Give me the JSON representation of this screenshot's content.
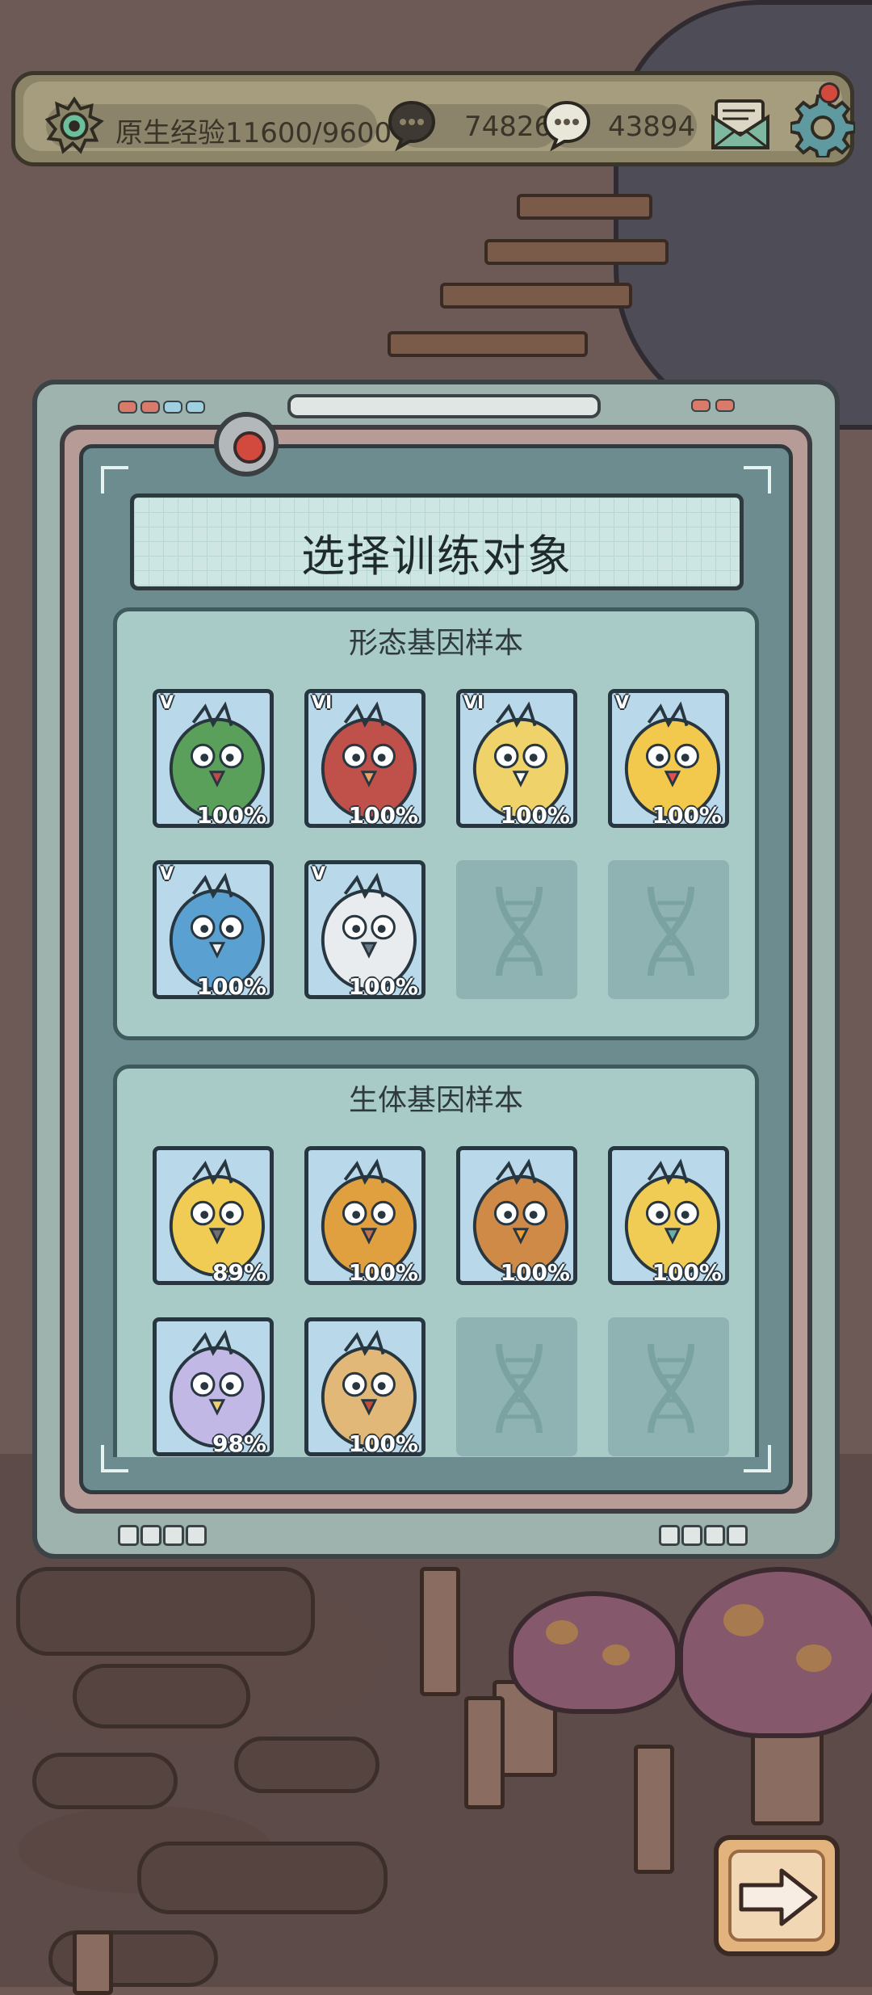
{
  "topbar": {
    "exp_label": "原生经验11600/9600",
    "currency_1": "74826",
    "currency_2": "43894"
  },
  "panel": {
    "title": "选择训练对象",
    "sections": [
      {
        "title": "形态基因样本",
        "cards": [
          {
            "grade": "V",
            "percent": "100%",
            "art": "green-zombie-bird"
          },
          {
            "grade": "VI",
            "percent": "100%",
            "art": "red-bird"
          },
          {
            "grade": "VI",
            "percent": "100%",
            "art": "yellow-crested-bird"
          },
          {
            "grade": "V",
            "percent": "100%",
            "art": "yellow-chick"
          },
          {
            "grade": "V",
            "percent": "100%",
            "art": "blue-fish-bird"
          },
          {
            "grade": "V",
            "percent": "100%",
            "art": "white-dragon-bird"
          },
          {
            "empty": true
          },
          {
            "empty": true
          }
        ]
      },
      {
        "title": "生体基因样本",
        "cards": [
          {
            "grade": "",
            "percent": "89%",
            "art": "smoke-horn-chick"
          },
          {
            "grade": "",
            "percent": "100%",
            "art": "orange-tentacle-bird"
          },
          {
            "grade": "",
            "percent": "100%",
            "art": "orange-eyed-bird"
          },
          {
            "grade": "",
            "percent": "100%",
            "art": "teal-sleepy-bird"
          },
          {
            "grade": "",
            "percent": "98%",
            "art": "lavender-bird"
          },
          {
            "grade": "",
            "percent": "100%",
            "art": "tan-third-eye-bird"
          },
          {
            "empty": true
          },
          {
            "empty": true
          }
        ]
      }
    ]
  },
  "colors": {
    "panel_screen": "#6d8c90",
    "section_bg": "#a8cbc8",
    "card_bg": "#b9d9ea",
    "accent_red": "#d24a3d"
  }
}
